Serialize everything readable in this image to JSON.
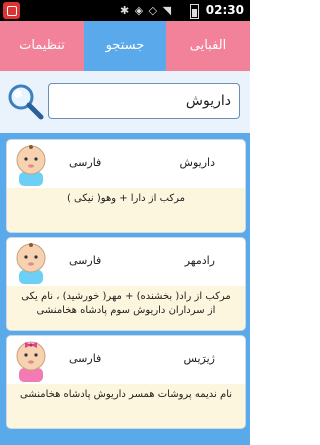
{
  "statusbar": {
    "time": "02:30",
    "icons": "✱ ◈ ◇ ◥"
  },
  "tabs": {
    "settings": "تنظیمات",
    "search": "جستجو",
    "alphabetical": "الفبایی"
  },
  "search": {
    "value": "داریوش"
  },
  "results": [
    {
      "name": "داریوش",
      "origin": "فارسی",
      "meaning": "مرکب از دارا + وهو( نیکی )",
      "gender": "boy"
    },
    {
      "name": "رادمهر",
      "origin": "فارسی",
      "meaning": "مرکب از راد( بخشنده) + مهر( خورشید) ، نام یکی از سرداران داریوش سوم پادشاه هخامنشی",
      "gender": "boy"
    },
    {
      "name": "ژیرَیس",
      "origin": "فارسی",
      "meaning": "نام ندیمه پروشات همسر داریوش پادشاه هخامنشی",
      "gender": "girl"
    }
  ]
}
